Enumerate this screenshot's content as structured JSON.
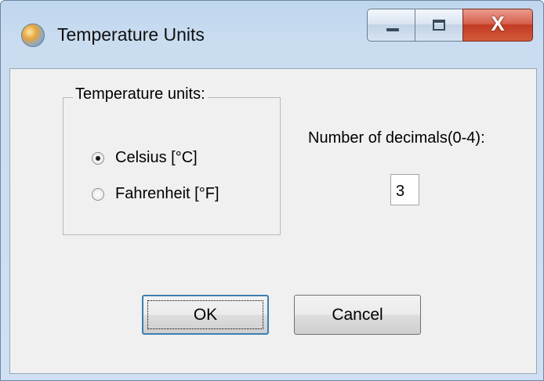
{
  "window": {
    "title": "Temperature Units",
    "icon": "globe-icon"
  },
  "title_controls": {
    "minimize_icon": "minimize-icon",
    "maximize_icon": "maximize-icon",
    "close_glyph": "X"
  },
  "units_group": {
    "legend": "Temperature units:",
    "options": [
      {
        "label": "Celsius [°C]",
        "checked": true
      },
      {
        "label": "Fahrenheit [°F]",
        "checked": false
      }
    ]
  },
  "decimals": {
    "label": "Number of decimals(0-4):",
    "value": "3"
  },
  "buttons": {
    "ok": "OK",
    "cancel": "Cancel"
  }
}
